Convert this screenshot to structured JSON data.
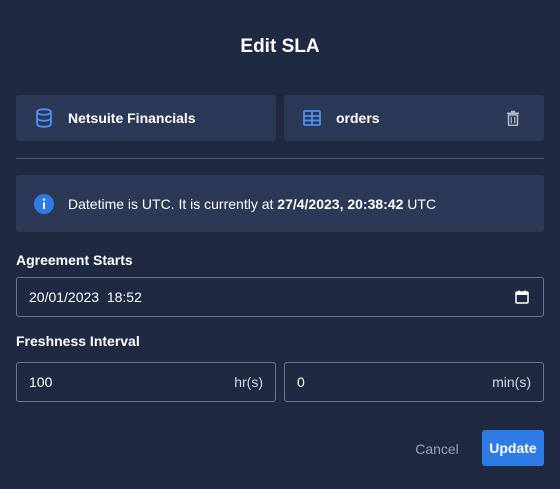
{
  "dialog": {
    "title": "Edit SLA"
  },
  "source": {
    "icon": "database-icon",
    "label": "Netsuite Financials"
  },
  "table": {
    "icon": "table-icon",
    "label": "orders",
    "delete_icon": "trash-icon"
  },
  "info": {
    "icon": "info-icon",
    "prefix": "Datetime is UTC. It is currently at ",
    "current_time": "27/4/2023, 20:38:42",
    "suffix": " UTC"
  },
  "agreement": {
    "label": "Agreement Starts",
    "value": "20/01/2023  18:52",
    "icon": "calendar-icon"
  },
  "freshness": {
    "label": "Freshness Interval",
    "hours_value": "100",
    "hours_unit": "hr(s)",
    "minutes_value": "0",
    "minutes_unit": "min(s)"
  },
  "actions": {
    "cancel_label": "Cancel",
    "update_label": "Update"
  },
  "colors": {
    "background": "#1f2942",
    "card": "#2b3956",
    "accent": "#2f7be6",
    "icon": "#4f8ff7"
  }
}
